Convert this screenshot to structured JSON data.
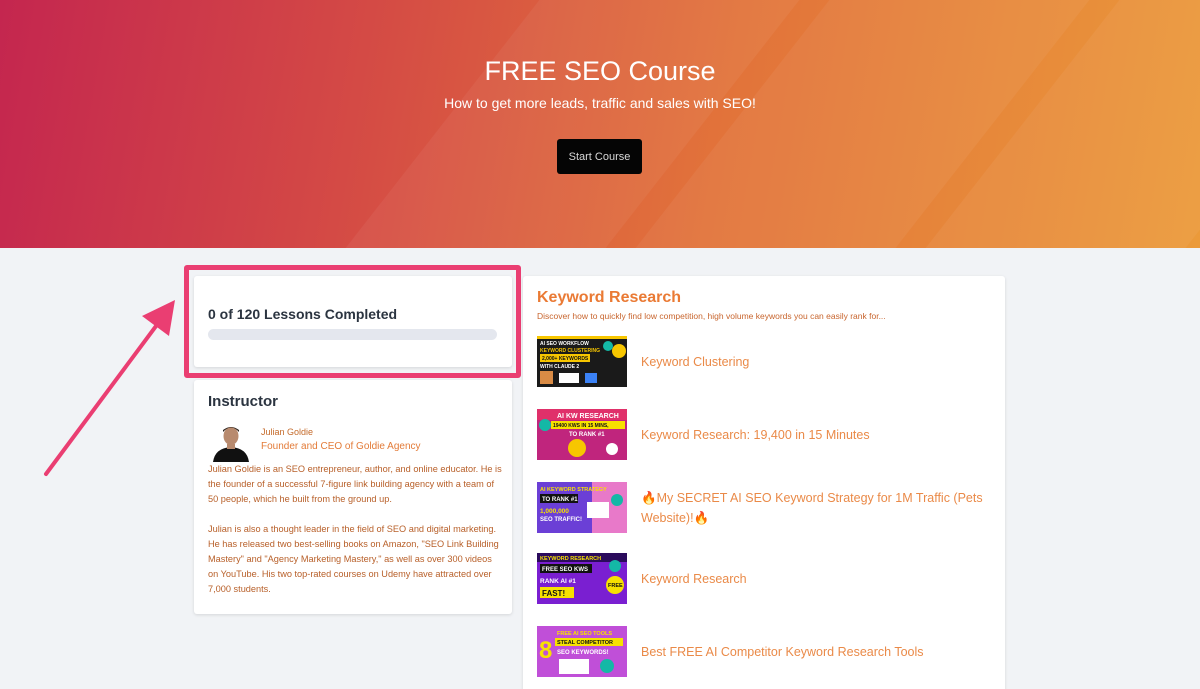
{
  "hero": {
    "title": "FREE SEO Course",
    "subtitle": "How to get more leads, traffic and sales with SEO!",
    "start_label": "Start Course"
  },
  "progress": {
    "text": "0 of 120 Lessons Completed",
    "completed": 0,
    "total": 120,
    "fraction": 0
  },
  "instructor": {
    "heading": "Instructor",
    "name": "Julian Goldie",
    "role": "Founder and CEO of Goldie Agency",
    "bio_1": "Julian Goldie is an SEO entrepreneur, author, and online educator. He is the founder of a successful 7-figure link building agency with a team of 50 people, which he built from the ground up.",
    "bio_2": "Julian is also a thought leader in the field of SEO and digital marketing. He has released two best-selling books on Amazon, \"SEO Link Building Mastery\" and \"Agency Marketing Mastery,\" as well as over 300 videos on YouTube. His two top-rated courses on Udemy have attracted over 7,000 students."
  },
  "module": {
    "title": "Keyword Research",
    "description": "Discover how to quickly find low competition, high volume keywords you can easily rank for...",
    "lessons": [
      {
        "title": "Keyword Clustering",
        "thumb": {
          "line1": "AI SEO WORKFLOW",
          "line2": "KEYWORD CLUSTERING",
          "line3": "2,000+ KEYWORDS",
          "line4": "WITH CLAUDE 2"
        }
      },
      {
        "title": "Keyword Research: 19,400 in 15 Minutes",
        "thumb": {
          "line1": "AI KW RESEARCH",
          "line2": "19400 KWS IN 15 MINS,",
          "line3": "TO RANK #1"
        }
      },
      {
        "title": "🔥My SECRET AI SEO Keyword Strategy for 1M Traffic (Pets Website)!🔥",
        "thumb": {
          "line1": "AI KEYWORD STRATEGY",
          "line2": "TO RANK #1",
          "line3": "1,000,000",
          "line4": "SEO TRAFFIC!"
        }
      },
      {
        "title": "Keyword Research",
        "thumb": {
          "line1": "KEYWORD RESEARCH",
          "line2": "FREE SEO KWS",
          "line3": "RANK AI #1",
          "line4": "FAST!",
          "badge": "FREE"
        }
      },
      {
        "title": "Best FREE AI Competitor Keyword Research Tools",
        "thumb": {
          "line1": "FREE AI SEO TOOLS",
          "line2": "STEAL COMPETITOR",
          "line3": "SEO KEYWORDS!",
          "big": "8"
        }
      }
    ]
  },
  "colors": {
    "accent": "#ea7a34",
    "highlight": "#ea3e72",
    "button_bg": "#050505"
  }
}
